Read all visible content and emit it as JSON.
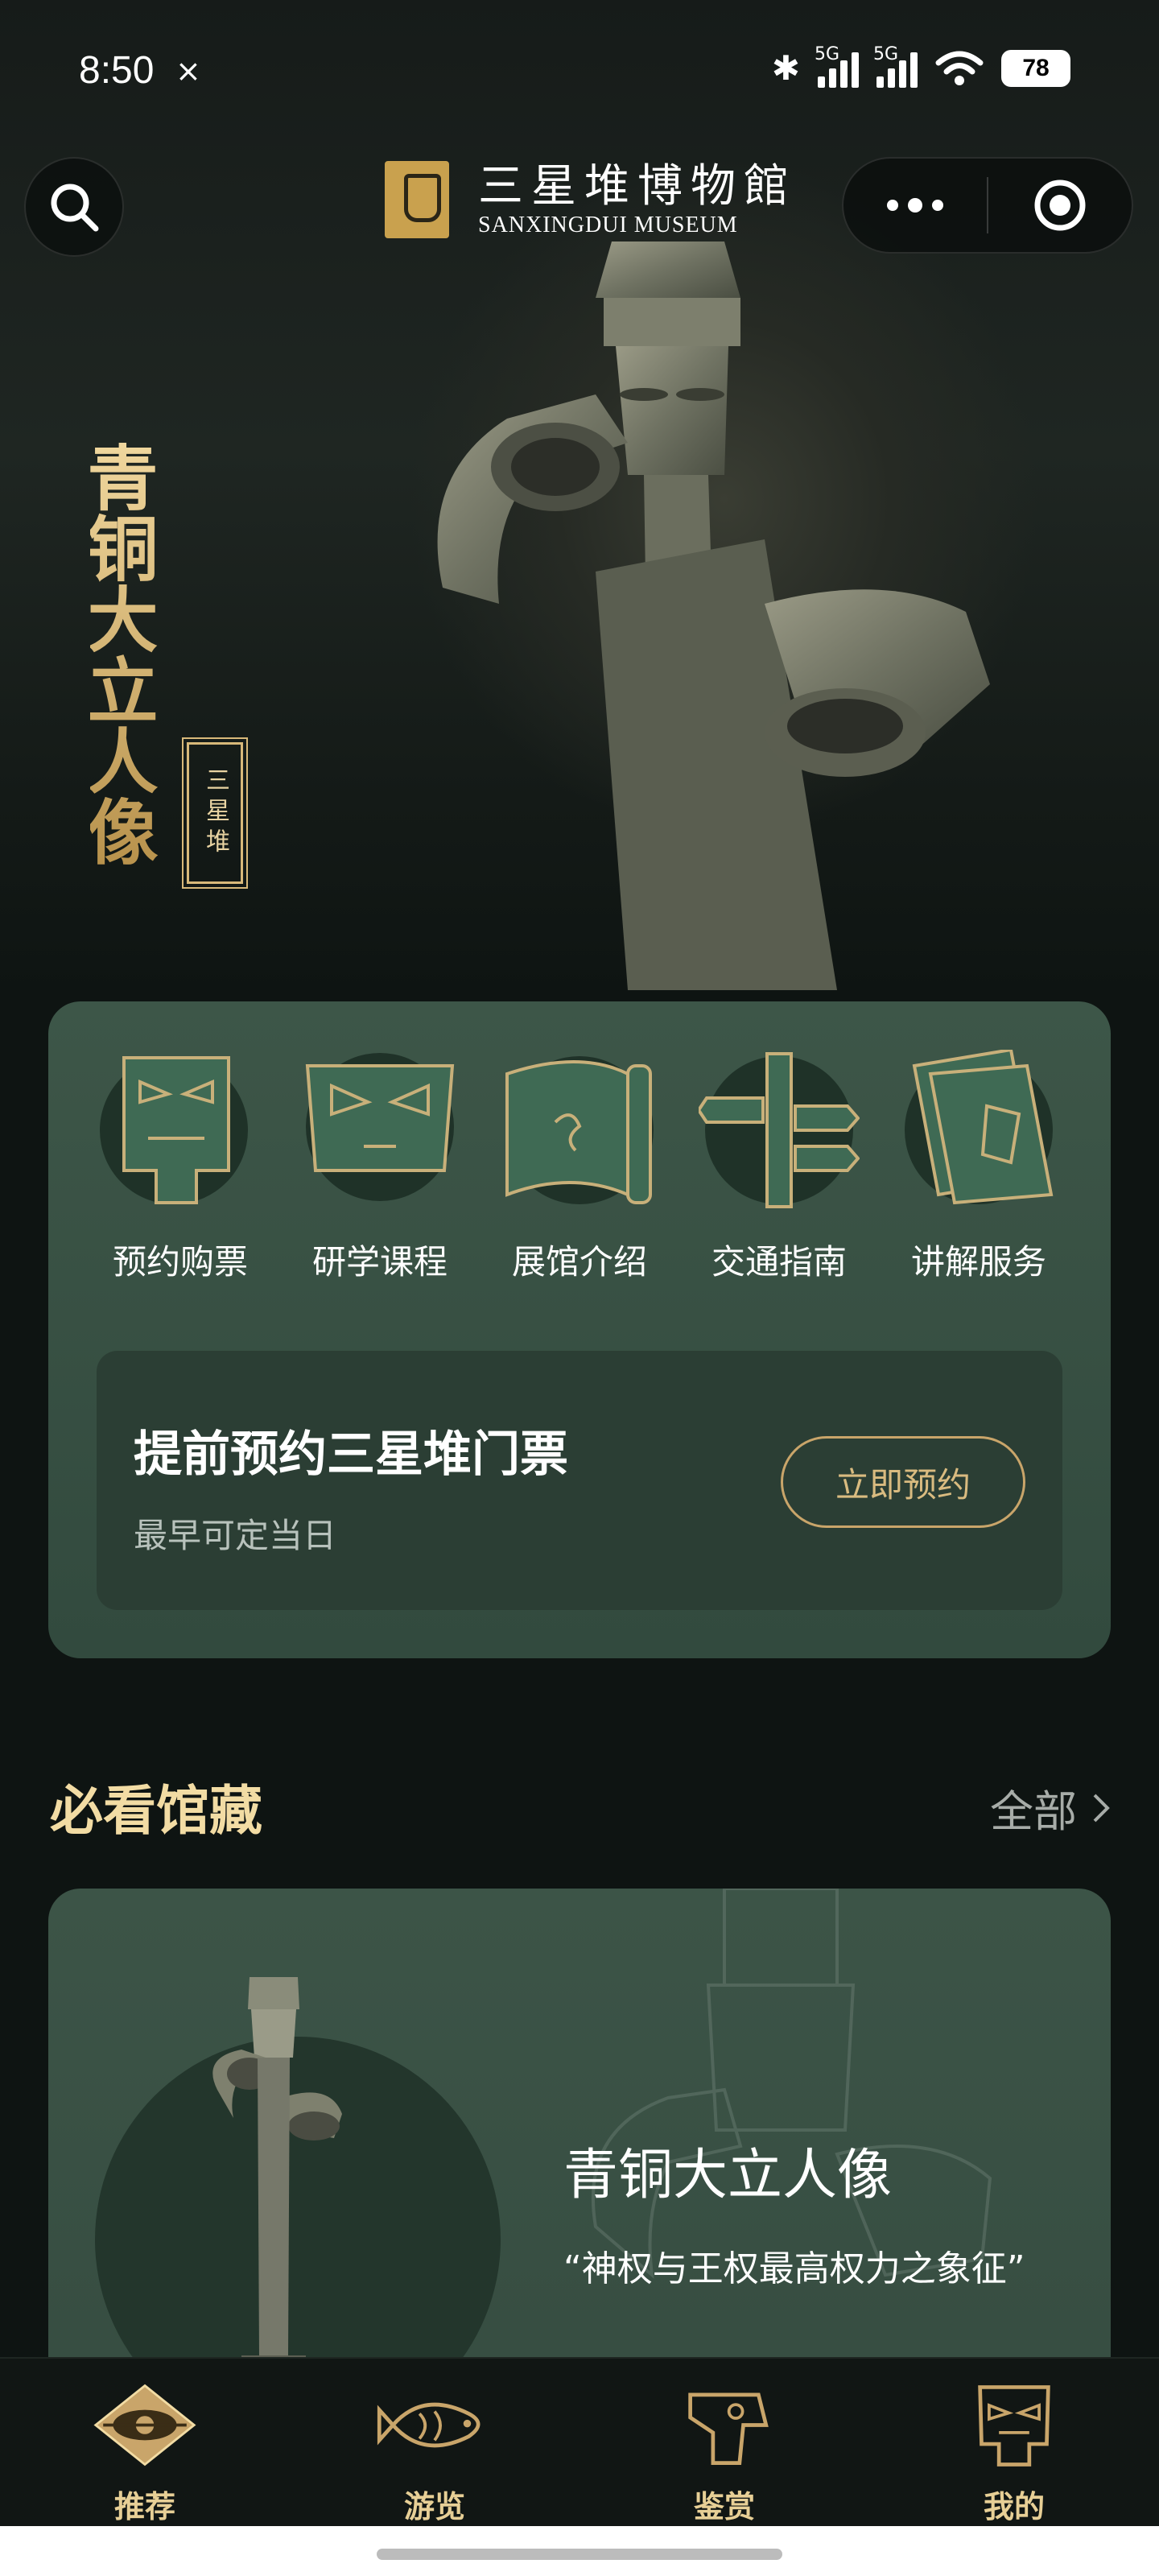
{
  "status_bar": {
    "time": "8:50",
    "extra_icon": "vpn-icon",
    "network_label_1": "5G",
    "network_label_2": "5G",
    "battery": "78"
  },
  "header": {
    "museum_name_cn": "三星堆博物館",
    "museum_name_en": "SANXINGDUI MUSEUM"
  },
  "hero": {
    "title": "青铜大立人像",
    "seal": "三星堆"
  },
  "services": [
    {
      "label": "预约购票",
      "icon": "mask-ticket-icon"
    },
    {
      "label": "研学课程",
      "icon": "mask-course-icon"
    },
    {
      "label": "展馆介绍",
      "icon": "scroll-hall-icon"
    },
    {
      "label": "交通指南",
      "icon": "signpost-icon"
    },
    {
      "label": "讲解服务",
      "icon": "guide-book-icon"
    }
  ],
  "booking": {
    "title": "提前预约三星堆门票",
    "subtitle": "最早可定当日",
    "button": "立即预约"
  },
  "collection": {
    "section_title": "必看馆藏",
    "see_all": "全部",
    "item_title": "青铜大立人像",
    "item_quote": "“神权与王权最高权力之象征”"
  },
  "tabs": [
    {
      "label": "推荐",
      "active": true
    },
    {
      "label": "游览",
      "active": false
    },
    {
      "label": "鉴赏",
      "active": false
    },
    {
      "label": "我的",
      "active": false
    }
  ],
  "colors": {
    "accent_gold": "#d9bb80",
    "card_green": "#3d5648",
    "background": "#0e1412"
  }
}
